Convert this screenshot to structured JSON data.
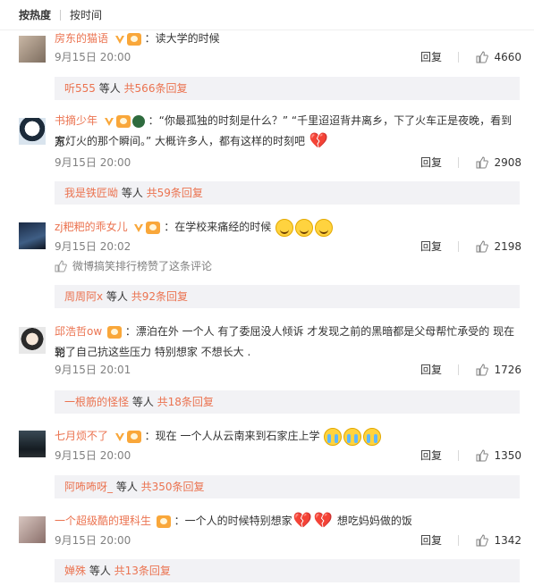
{
  "tabs": {
    "hot": "按热度",
    "time": "按时间"
  },
  "common": {
    "reply": "回复"
  },
  "comments": [
    {
      "user": "房东的猫语",
      "text": "：读大学的时候",
      "time": "9月15日 20:00",
      "likes": "4660",
      "replies": {
        "who": "听555",
        "mid": " 等人 ",
        "more": "共566条回复"
      }
    },
    {
      "user": "书摘少年",
      "text": "：“你最孤独的时刻是什么？” “千里迢迢背井离乡，下了火车正是夜晚，看到万",
      "text2": "家灯火的那个瞬间。” 大概许多人，都有这样的时刻吧",
      "time": "9月15日 20:00",
      "likes": "2908",
      "replies": {
        "who": "我是铁匠呦",
        "mid": " 等人 ",
        "more": "共59条回复"
      }
    },
    {
      "user": "zj粑粑的乖女儿",
      "text": "：在学校来痛经的时候",
      "time": "9月15日 20:02",
      "likes": "2198",
      "liked_by": {
        "who": "微博搞笑排行榜",
        "rest": " 赞了这条评论"
      },
      "replies": {
        "who": "周周阿x",
        "mid": " 等人 ",
        "more": "共92条回复"
      }
    },
    {
      "user": "邱浩哲ow",
      "text": "：漂泊在外 一个人 有了委屈没人倾诉 才发现之前的黑暗都是父母帮忙承受的 现在轮",
      "text2": "到了自己抗这些压力  特别想家 不想长大 .",
      "time": "9月15日 20:01",
      "likes": "1726",
      "replies": {
        "who": "一根筋的怪怪",
        "mid": " 等人 ",
        "more": "共18条回复"
      }
    },
    {
      "user": "七月烦不了",
      "text": "：现在 一个人从云南来到石家庄上学",
      "time": "9月15日 20:00",
      "likes": "1350",
      "replies": {
        "who": "阿咘咘呀_",
        "mid": " 等人 ",
        "more": "共350条回复"
      }
    },
    {
      "user": "一个超级酷的理科生",
      "text": "：一个人的时候特别想家",
      "text_after": " 想吃妈妈做的饭",
      "time": "9月15日 20:00",
      "likes": "1342",
      "replies": {
        "who": "婵殊",
        "mid": " 等人 ",
        "more": "共13条回复"
      }
    }
  ],
  "colors": {
    "username": "#eb7350",
    "reply_bg": "#f2f2f5",
    "badge_v": "#f9a73a",
    "heart": "#c3202b"
  }
}
